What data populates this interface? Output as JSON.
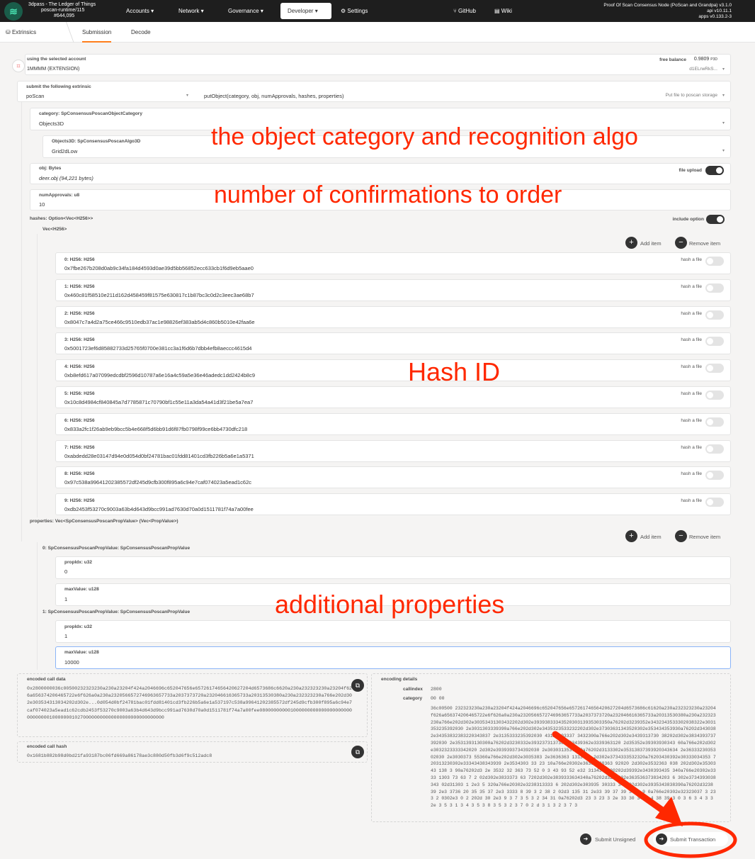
{
  "nav": {
    "chain_name": "3dpass - The Ledger of Things",
    "runtime": "poscan-runtime/115",
    "block": "#644,095",
    "items": [
      "Accounts",
      "Network",
      "Governance",
      "Developer",
      "Settings",
      "GitHub",
      "Wiki"
    ],
    "node_name": "Proof Of Scan Consensus Node (PoScan and Grandpa) v3.1.0",
    "api_version": "api v10.11.1",
    "apps_version": "apps v0.133.2-3"
  },
  "subnav": {
    "section": "Extrinsics",
    "tabs": [
      "Submission",
      "Decode"
    ]
  },
  "account": {
    "label": "using the selected account",
    "name": "1MMMM (EXTENSION)",
    "balance_label": "free balance",
    "balance_value": "0.9809",
    "balance_unit": "P3D",
    "address_short": "d1ELrwRkS..."
  },
  "extrinsic": {
    "label": "submit the following extrinsic",
    "pallet": "poScan",
    "call": "putObject(category, obj, numApprovals, hashes, properties)",
    "call_doc": "Put file to poscan storage"
  },
  "category": {
    "label": "category: SpConsensusPoscanObjectCategory",
    "value": "Objects3D",
    "sub_label": "Objects3D: SpConsensusPoscanAlgo3D",
    "sub_value": "Grid2dLow"
  },
  "obj": {
    "label": "obj: Bytes",
    "value": "deer.obj (94,221 bytes)",
    "toggle_label": "file upload"
  },
  "approvals": {
    "label": "numApprovals: u8",
    "value": "10"
  },
  "hashes": {
    "label": "hashes: Option<Vec<H256>>",
    "option_label": "include option",
    "vec_label": "Vec<H256>",
    "add_label": "Add item",
    "remove_label": "Remove item",
    "hash_file_label": "hash a file",
    "items": [
      {
        "label": "0: H256: H256",
        "value": "0x7fbe267b208d0ab9c34fa184d4593d0ae39d5bb56852ecc633cb1f6d9eb5aae0"
      },
      {
        "label": "1: H256: H256",
        "value": "0x460c81f58510e211d162d458459f81575e630817c1b87bc3c0d2c3eec3ae68b7"
      },
      {
        "label": "2: H256: H256",
        "value": "0x8047c7a4d2a75ce466c9510edb37ac1e98826ef383ab5d4c860b5010e42faa6e"
      },
      {
        "label": "3: H256: H256",
        "value": "0x5001723ef6d85882733d25765f0700e381cc3a1f6d6b7dbb4efb8aeccc4615d4"
      },
      {
        "label": "4: H256: H256",
        "value": "0xb8efd617a07099edcdbf2596d10787a6e16a4c59a5e36e46adedc1dd2424b8c9"
      },
      {
        "label": "5: H256: H256",
        "value": "0x10c8d4984cf840845a7d7785871c70790bf1c55e11a3da54a41d3f21be5a7ea7"
      },
      {
        "label": "6: H256: H256",
        "value": "0x833a2fc1f26ab9eb9bcc5b4e668f5d6bb91d6f87fb0798f99ce6bb4730dfc218"
      },
      {
        "label": "7: H256: H256",
        "value": "0xabdedd28e03147d94e0d054d0bf24781bac01fdd81401cd3fb226b5a6e1a5371"
      },
      {
        "label": "8: H256: H256",
        "value": "0x97c538a99641202385572df245d9cfb300f895a6c94e7caf074023a5ead1c62c"
      },
      {
        "label": "9: H256: H256",
        "value": "0xdb2453f53270c9003a63b4d643d9bcc991ad7630d70a0d1511781f74a7a00fee"
      }
    ]
  },
  "properties": {
    "label": "properties: Vec<SpConsensusPoscanPropValue> (Vec<PropValue>)",
    "add_label": "Add item",
    "remove_label": "Remove item",
    "items": [
      {
        "label": "0: SpConsensusPoscanPropValue: SpConsensusPoscanPropValue",
        "propidx_label": "propIdx: u32",
        "propidx_value": "0",
        "maxvalue_label": "maxValue: u128",
        "maxvalue_value": "1"
      },
      {
        "label": "1: SpConsensusPoscanPropValue: SpConsensusPoscanPropValue",
        "propidx_label": "propIdx: u32",
        "propidx_value": "1",
        "maxvalue_label": "maxValue: u128",
        "maxvalue_value": "10000"
      }
    ]
  },
  "encoded": {
    "call_data_label": "encoded call data",
    "call_data": "0x2800000036c00500232323230a230a23204f424a2046696c652047656e65726174656420627204d6573686c6620a230a232323230a23204f626a656374206465722e6f626a0a230a2320566572746963657733a2037373720a232046616365733a20313530380a230a232323230a766e202d302e303534313034202d302e...0d054d0bf24781bac01fdd81401cd3fb226b5a6e1a537197c538a99641202385572df245d9cfb300f895a6c94e7caf074023a5ead1c62cdb2453f53270c9003a63b4d643d9bcc991ad7630d70a0d1511781f74a7a00fee0800000000010000000000000000000000000000010000000102700000000000000000000000000000",
    "call_hash_label": "encoded call hash",
    "call_hash": "0x1681b882b98d0bd21fa93187bc06fd669a86178ae3c880d50fb3d6f9c512adc8",
    "details_label": "encoding details",
    "callindex_label": "callindex",
    "callindex_value": "2800",
    "category_label": "category",
    "category_value": "00 00",
    "details_data": "36c00500 232323230a230a23204f424a2046696c652047656e65726174656420627204d6573686c61620a230a232323230a23204f626a656374206465722e6f626a0a230a2320566572746963657733a2037373720a232046616365733a20313530380a230a232323230a766e202d302e30353431303432202d302e3939383334352030313935303350a76202d3239352e3432343533302038322e3031353235392030 2e3031303339390a766e202d302e3435323533232202d302e37303631343520302e353434353930a76202d3430382e34353832383220343837 2e3135333235392030 4312e393337 3432300a766e202d302e3439313730 38202d302e3834393737392030 2e3531393130300a76202d3230332e393237313730 203439362e3339363120 2d35352e39303930343 60a766e202d302e3032323333342020 2d302e3939393734392030 2e3030313537360a76202d3133302e35313837393920343634 2e3633323035302030 2e3030373 55360a766e202d302e3035383 2e3636363 1313020 2d302e3734333532320a76203430392e30333034353 720313230302e33343438343939 2e3534303 33 23 10a766e20302e36383438363 92020 2d302e3532363 038 202d302e3530343 138 3 90a76202d3 2e 3532 32 363 73 52 0 3 43 93 52 e32 3134363030202d39392e3430393435 340a766e20302e3333 1303 73 63 7 2 02d302e3833373 63 7202d302e3839333634340a76202d3232302e363536373834203 6 302e3734393038343 02d31303 1 2e3 5 320a766e20302e3238313333 6 202d302e303935 30333 342 02d302e3935343838390a76202d3238 39 2e3 3736 20 35 35 37 2e3 3333 8 39 3 2 38 2 02d3 135 31 2e33 39 37 39 34 3 9 0a766e20302e32323037 3 23 3 2 0302e3 0 2 202d 30 2e3 9 3 7 3 5 3 2 34 31 0a76202d3 23 3 23 3 2e 33 30 34 3 4 38 39 3 0 3 6 3 4 3 3 2e 3 5 3 1 3 4 3 5 3 8 3 5 3 2 3 7 0 2 d 3 1 3 2 3 7 3"
  },
  "actions": {
    "submit_unsigned": "Submit Unsigned",
    "submit_transaction": "Submit Transaction"
  },
  "annotations": {
    "category_note": "the object category and recognition algo",
    "approvals_note": "number of confirmations to order",
    "hash_note": "Hash ID",
    "properties_note": "additional properties"
  },
  "colors": {
    "annotation_red": "#ff2800",
    "nav_bg": "#1e1e1e",
    "accent_orange": "#ff7e1c"
  }
}
